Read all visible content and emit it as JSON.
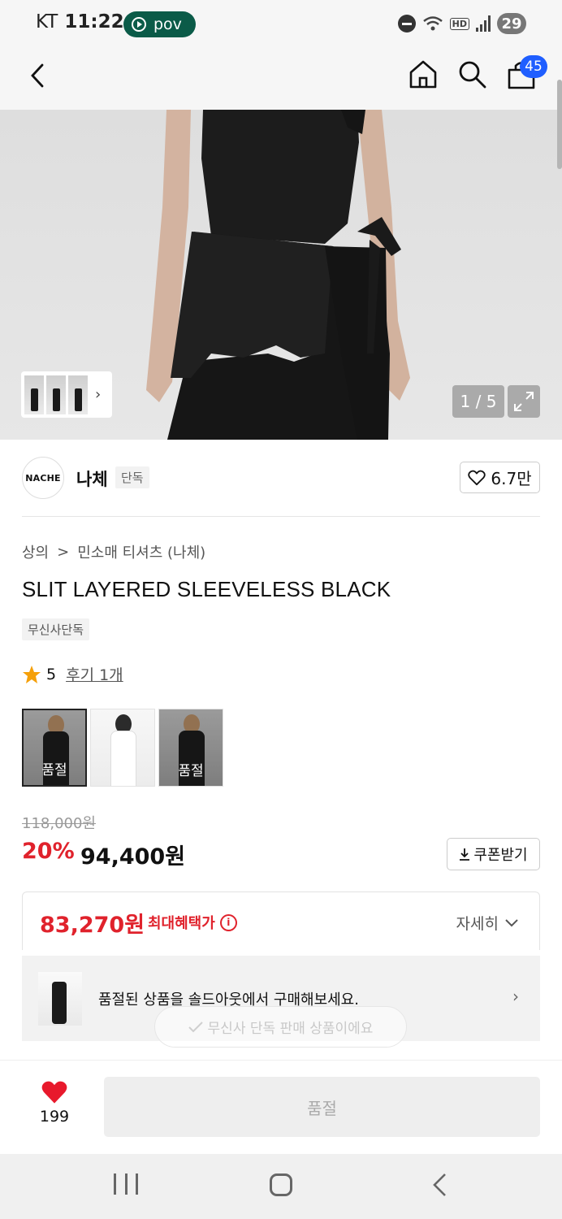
{
  "status_bar": {
    "carrier": "KT",
    "time": "11:22",
    "recording_label": "pov",
    "hd": "HD",
    "battery": "29"
  },
  "header": {
    "cart_count": "45"
  },
  "gallery": {
    "counter": "1 / 5"
  },
  "brand": {
    "logo_text": "NACHE",
    "name": "나체",
    "tag": "단독",
    "likes": "6.7만"
  },
  "breadcrumb": {
    "level1": "상의",
    "separator": ">",
    "level2": "민소매 티셔츠 (나체)"
  },
  "product": {
    "title": "SLIT LAYERED SLEEVELESS BLACK",
    "exclusive_tag": "무신사단독",
    "rating": "5",
    "review_link": "후기 1개"
  },
  "color_options": [
    {
      "label": "품절",
      "selected": true
    },
    {
      "label": "",
      "selected": false
    },
    {
      "label": "품절",
      "selected": false
    }
  ],
  "price": {
    "original": "118,000원",
    "discount": "20%",
    "current": "94,400원",
    "coupon_label": "쿠폰받기"
  },
  "benefit": {
    "max_price": "83,270원",
    "label": "최대혜택가",
    "detail_label": "자세히"
  },
  "soldout_banner": {
    "message": "품절된 상품을 솔드아웃에서 구매해보세요."
  },
  "toast": {
    "message": "무신사 단독 판매 상품이에요"
  },
  "bottom_bar": {
    "like_count": "199",
    "buy_label": "품절"
  },
  "colors": {
    "accent_red": "#e0222c",
    "badge_blue": "#1f5eff",
    "pov_green": "#0b5b48"
  }
}
